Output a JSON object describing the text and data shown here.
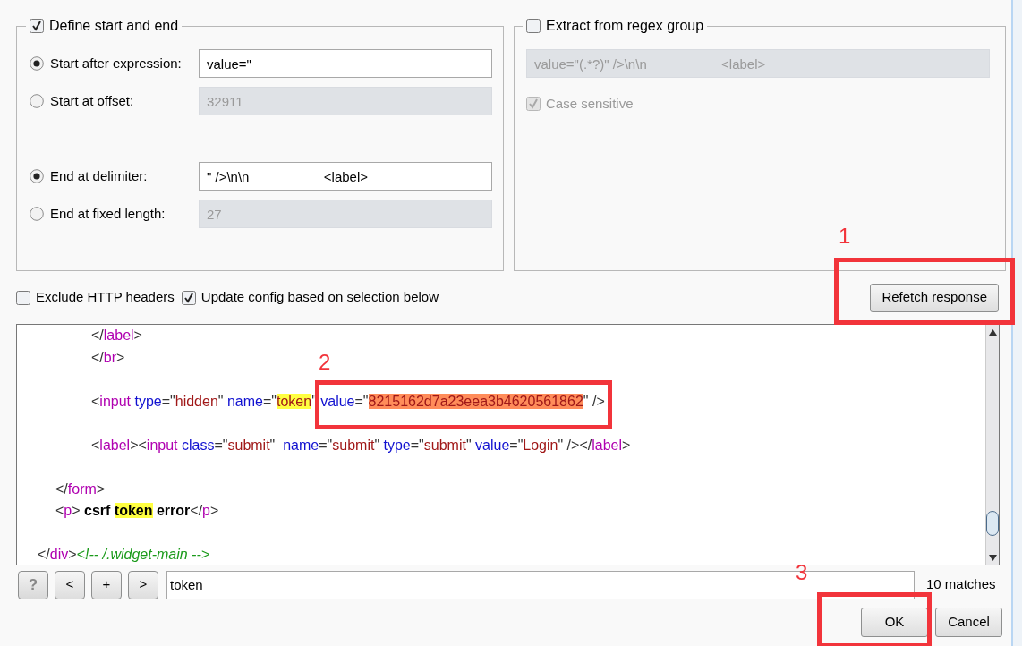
{
  "start_end": {
    "label": "Define start and end",
    "checked": true,
    "start_options": [
      {
        "label": "Start after expression:",
        "selected": true,
        "value": "value=\""
      },
      {
        "label": "Start at offset:",
        "selected": false,
        "value": "32911"
      }
    ],
    "end_options": [
      {
        "label": "End at delimiter:",
        "selected": true,
        "value": "\" />\\n\\n                    <label>"
      },
      {
        "label": "End at fixed length:",
        "selected": false,
        "value": "27"
      }
    ]
  },
  "regex_group": {
    "label": "Extract from regex group",
    "checked": false,
    "pattern": "value=\"(.*?)\" />\\n\\n                    <label>",
    "case_sensitive": {
      "label": "Case sensitive",
      "checked": true
    }
  },
  "options": [
    {
      "label": "Exclude HTTP headers",
      "checked": false
    },
    {
      "label": "Update config based on selection below",
      "checked": true
    }
  ],
  "refetch_button": "Refetch response",
  "editor_lines": [
    {
      "kind": "code",
      "segments": [
        {
          "kind": "punct",
          "text": "\t\t\t\t</"
        },
        {
          "kind": "tag",
          "text": "label"
        },
        {
          "kind": "punct",
          "text": ">"
        }
      ]
    },
    {
      "kind": "code",
      "segments": [
        {
          "kind": "punct",
          "text": "\t\t\t\t</"
        },
        {
          "kind": "tag",
          "text": "br"
        },
        {
          "kind": "punct",
          "text": ">"
        }
      ]
    },
    {
      "kind": "blank"
    },
    {
      "kind": "code",
      "segments": [
        {
          "kind": "punct",
          "text": "\t\t\t\t<"
        },
        {
          "kind": "tag",
          "text": "input"
        },
        {
          "kind": "attr",
          "text": " type"
        },
        {
          "kind": "punct",
          "text": "=\""
        },
        {
          "kind": "value",
          "text": "hidden"
        },
        {
          "kind": "punct",
          "text": "\" "
        },
        {
          "kind": "attr",
          "text": "name"
        },
        {
          "kind": "punct",
          "text": "=\""
        },
        {
          "kind": "value",
          "text": "token",
          "search_match": true
        },
        {
          "kind": "punct",
          "text": "\" "
        },
        {
          "kind": "attr",
          "text": "value"
        },
        {
          "kind": "punct",
          "text": "=\""
        },
        {
          "kind": "value",
          "text": "8215162d7a23eea3b4620561862",
          "selected": true
        },
        {
          "kind": "punct",
          "text": "\" />"
        }
      ]
    },
    {
      "kind": "blank"
    },
    {
      "kind": "code",
      "segments": [
        {
          "kind": "punct",
          "text": "\t\t\t\t<"
        },
        {
          "kind": "tag",
          "text": "label"
        },
        {
          "kind": "punct",
          "text": "><"
        },
        {
          "kind": "tag",
          "text": "input"
        },
        {
          "kind": "attr",
          "text": " class"
        },
        {
          "kind": "punct",
          "text": "=\""
        },
        {
          "kind": "value",
          "text": "submit"
        },
        {
          "kind": "punct",
          "text": "\"  "
        },
        {
          "kind": "attr",
          "text": "name"
        },
        {
          "kind": "punct",
          "text": "=\""
        },
        {
          "kind": "value",
          "text": "submit"
        },
        {
          "kind": "punct",
          "text": "\" "
        },
        {
          "kind": "attr",
          "text": "type"
        },
        {
          "kind": "punct",
          "text": "=\""
        },
        {
          "kind": "value",
          "text": "submit"
        },
        {
          "kind": "punct",
          "text": "\" "
        },
        {
          "kind": "attr",
          "text": "value"
        },
        {
          "kind": "punct",
          "text": "=\""
        },
        {
          "kind": "value",
          "text": "Login"
        },
        {
          "kind": "punct",
          "text": "\" /></"
        },
        {
          "kind": "tag",
          "text": "label"
        },
        {
          "kind": "punct",
          "text": ">"
        }
      ]
    },
    {
      "kind": "blank"
    },
    {
      "kind": "code",
      "segments": [
        {
          "kind": "punct",
          "text": "\t\t</"
        },
        {
          "kind": "tag",
          "text": "form"
        },
        {
          "kind": "punct",
          "text": ">"
        }
      ]
    },
    {
      "kind": "code",
      "segments": [
        {
          "kind": "punct",
          "text": "\t\t<"
        },
        {
          "kind": "tag",
          "text": "p"
        },
        {
          "kind": "punct",
          "text": "> "
        },
        {
          "kind": "bold",
          "text": "csrf "
        },
        {
          "kind": "bold",
          "text": "token",
          "search_match": true
        },
        {
          "kind": "bold",
          "text": " error"
        },
        {
          "kind": "punct",
          "text": "</"
        },
        {
          "kind": "tag",
          "text": "p"
        },
        {
          "kind": "punct",
          "text": ">"
        }
      ]
    },
    {
      "kind": "blank"
    },
    {
      "kind": "code",
      "segments": [
        {
          "kind": "punct",
          "text": "\t</"
        },
        {
          "kind": "tag",
          "text": "div"
        },
        {
          "kind": "punct",
          "text": ">"
        },
        {
          "kind": "comment",
          "text": "<!-- /.widget-main -->"
        }
      ]
    }
  ],
  "search": {
    "buttons": [
      "?",
      "<",
      "+",
      ">"
    ],
    "value": "token",
    "matches": "10 matches"
  },
  "dialog_buttons": [
    "OK",
    "Cancel"
  ],
  "annotations": [
    {
      "label": "1"
    },
    {
      "label": "2"
    },
    {
      "label": "3"
    }
  ]
}
